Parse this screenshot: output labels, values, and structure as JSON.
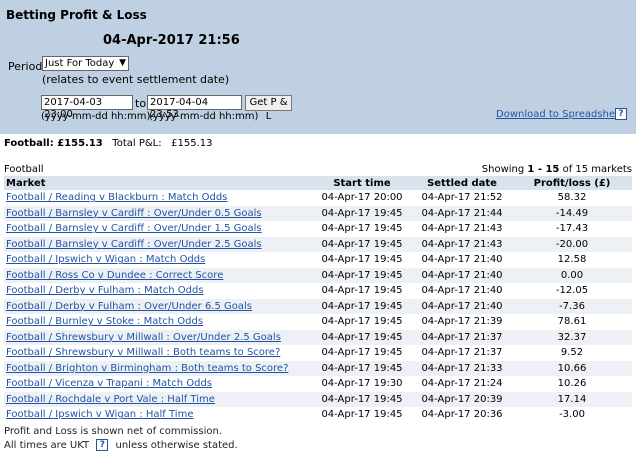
{
  "header": {
    "title": "Betting Profit & Loss",
    "datetime": "04-Apr-2017 21:56",
    "period_label": "Period:",
    "period_value": "Just For Today",
    "period_note": "(relates to event settlement date)",
    "from_value": "2017-04-03 23:00",
    "to_label": "to",
    "to_value": "2017-04-04 23:53",
    "get_button": "Get P & L",
    "from_format": "(yyyy-mm-dd hh:mm)",
    "to_format": "(yyyy-mm-dd hh:mm)",
    "download_link": "Download to Spreadsheet",
    "help_glyph": "?"
  },
  "summary": {
    "sport_label": "Football: £155.13",
    "total_label": "Total P&L:",
    "total_value": "£155.13"
  },
  "table": {
    "section": "Football",
    "showing": "Showing 1 - 15 of 15 markets",
    "headers": [
      "Market",
      "Start time",
      "Settled date",
      "Profit/loss (£)"
    ],
    "rows": [
      {
        "market": "Football / Reading v Blackburn : Match Odds",
        "start": "04-Apr-17 20:00",
        "settled": "04-Apr-17 21:52",
        "pl": "58.32"
      },
      {
        "market": "Football / Barnsley v Cardiff : Over/Under 0.5 Goals",
        "start": "04-Apr-17 19:45",
        "settled": "04-Apr-17 21:44",
        "pl": "-14.49"
      },
      {
        "market": "Football / Barnsley v Cardiff : Over/Under 1.5 Goals",
        "start": "04-Apr-17 19:45",
        "settled": "04-Apr-17 21:43",
        "pl": "-17.43"
      },
      {
        "market": "Football / Barnsley v Cardiff : Over/Under 2.5 Goals",
        "start": "04-Apr-17 19:45",
        "settled": "04-Apr-17 21:43",
        "pl": "-20.00"
      },
      {
        "market": "Football / Ipswich v Wigan : Match Odds",
        "start": "04-Apr-17 19:45",
        "settled": "04-Apr-17 21:40",
        "pl": "12.58"
      },
      {
        "market": "Football / Ross Co v Dundee : Correct Score",
        "start": "04-Apr-17 19:45",
        "settled": "04-Apr-17 21:40",
        "pl": "0.00"
      },
      {
        "market": "Football / Derby v Fulham : Match Odds",
        "start": "04-Apr-17 19:45",
        "settled": "04-Apr-17 21:40",
        "pl": "-12.05"
      },
      {
        "market": "Football / Derby v Fulham : Over/Under 6.5 Goals",
        "start": "04-Apr-17 19:45",
        "settled": "04-Apr-17 21:40",
        "pl": "-7.36"
      },
      {
        "market": "Football / Burnley v Stoke : Match Odds",
        "start": "04-Apr-17 19:45",
        "settled": "04-Apr-17 21:39",
        "pl": "78.61"
      },
      {
        "market": "Football / Shrewsbury v Millwall : Over/Under 2.5 Goals",
        "start": "04-Apr-17 19:45",
        "settled": "04-Apr-17 21:37",
        "pl": "32.37"
      },
      {
        "market": "Football / Shrewsbury v Millwall : Both teams to Score?",
        "start": "04-Apr-17 19:45",
        "settled": "04-Apr-17 21:37",
        "pl": "9.52"
      },
      {
        "market": "Football / Brighton v Birmingham : Both teams to Score?",
        "start": "04-Apr-17 19:45",
        "settled": "04-Apr-17 21:33",
        "pl": "10.66"
      },
      {
        "market": "Football / Vicenza v Trapani : Match Odds",
        "start": "04-Apr-17 19:30",
        "settled": "04-Apr-17 21:24",
        "pl": "10.26"
      },
      {
        "market": "Football / Rochdale v Port Vale : Half Time",
        "start": "04-Apr-17 19:45",
        "settled": "04-Apr-17 20:39",
        "pl": "17.14"
      },
      {
        "market": "Football / Ipswich v Wigan : Half Time",
        "start": "04-Apr-17 19:45",
        "settled": "04-Apr-17 20:36",
        "pl": "-3.00"
      }
    ]
  },
  "footer": {
    "commission_note": "Profit and Loss is shown net of commission.",
    "times_prefix": "All times are UKT",
    "times_suffix": "unless otherwise stated."
  }
}
